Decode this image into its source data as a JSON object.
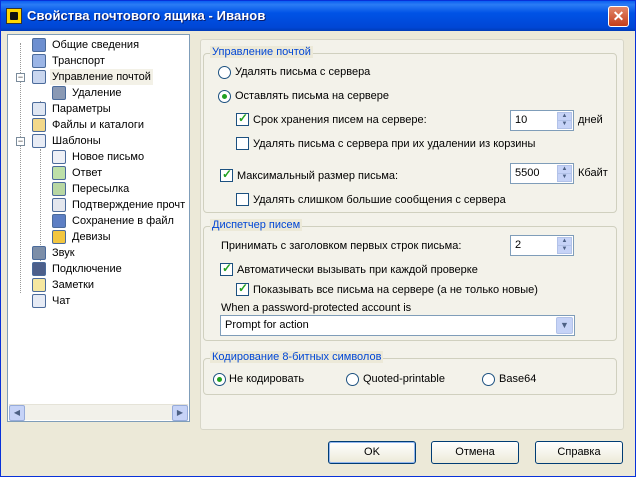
{
  "window": {
    "title": "Свойства почтового ящика - Иванов",
    "close_label": "✕"
  },
  "tree": {
    "items": [
      {
        "label": "Общие сведения",
        "icon": "info-icon"
      },
      {
        "label": "Транспорт",
        "icon": "transport-icon"
      },
      {
        "label": "Управление почтой",
        "icon": "mail-management-icon"
      },
      {
        "label": "Удаление",
        "icon": "trash-icon"
      },
      {
        "label": "Параметры",
        "icon": "settings-icon"
      },
      {
        "label": "Файлы и каталоги",
        "icon": "folder-icon"
      },
      {
        "label": "Шаблоны",
        "icon": "templates-icon"
      },
      {
        "label": "Новое письмо",
        "icon": "new-mail-icon"
      },
      {
        "label": "Ответ",
        "icon": "reply-icon"
      },
      {
        "label": "Пересылка",
        "icon": "forward-icon"
      },
      {
        "label": "Подтверждение прочт",
        "icon": "receipt-icon"
      },
      {
        "label": "Сохранение в файл",
        "icon": "save-icon"
      },
      {
        "label": "Девизы",
        "icon": "motto-icon"
      },
      {
        "label": "Звук",
        "icon": "sound-icon"
      },
      {
        "label": "Подключение",
        "icon": "connection-icon"
      },
      {
        "label": "Заметки",
        "icon": "notes-icon"
      },
      {
        "label": "Чат",
        "icon": "chat-icon"
      }
    ],
    "scroll_left": "◀",
    "scroll_right": "▶"
  },
  "mail_management": {
    "title": "Управление почтой",
    "delete_from_server": "Удалять письма с сервера",
    "keep_on_server": "Оставлять письма на сервере",
    "retention_label": "Срок хранения писем на сервере:",
    "retention_value": "10",
    "retention_unit": "дней",
    "delete_on_trash": "Удалять письма с сервера при их удалении из корзины",
    "max_size_label": "Максимальный размер письма:",
    "max_size_value": "5500",
    "max_size_unit": "Кбайт",
    "delete_large": "Удалять слишком большие сообщения с сервера"
  },
  "dispatcher": {
    "title": "Диспетчер писем",
    "header_lines_label": "Принимать с заголовком первых строк письма:",
    "header_lines_value": "2",
    "auto_check": "Автоматически вызывать при каждой проверке",
    "show_all": "Показывать все письма на сервере (а не только новые)",
    "password_label": "When a password-protected account is",
    "password_option": "Prompt for action"
  },
  "encoding": {
    "title": "Кодирование 8-битных символов",
    "none": "Не кодировать",
    "qp": "Quoted-printable",
    "b64": "Base64"
  },
  "buttons": {
    "ok": "OK",
    "cancel": "Отмена",
    "help": "Справка"
  },
  "colors": {
    "title_bar": "#0053e6",
    "group_title": "#0046d5",
    "check": "#21a121"
  }
}
